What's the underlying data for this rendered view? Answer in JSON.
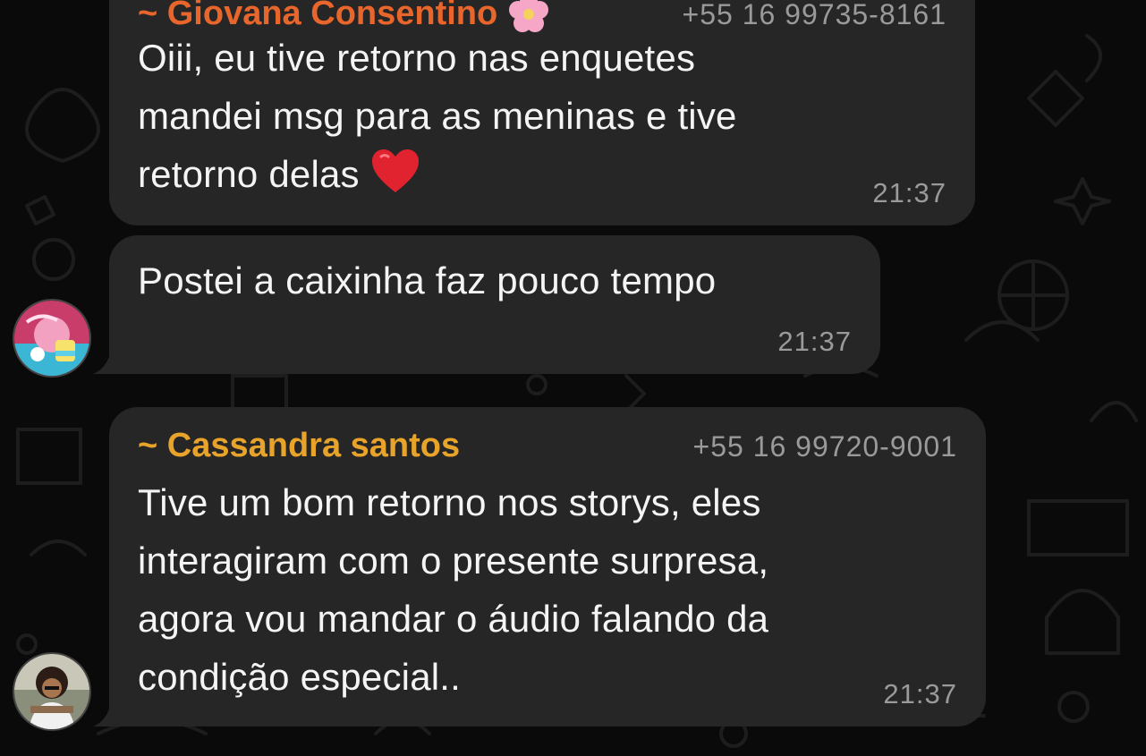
{
  "messages": [
    {
      "sender": "~ Giovana Consentino",
      "sender_emoji": "flower-emoji",
      "phone": "+55 16 99735-8161",
      "text": "Oiii, eu tive retorno nas enquetes\nmandei msg para as meninas e tive\nretorno delas",
      "emoji": "red-heart-emoji",
      "time": "21:37",
      "name_color": "#e8662b"
    },
    {
      "text": "Postei a caixinha faz pouco tempo",
      "time": "21:37"
    },
    {
      "sender": "~ Cassandra santos",
      "phone": "+55 16 99720-9001",
      "text": "Tive um bom retorno nos storys, eles\ninteragiram com o presente surpresa,\nagora vou mandar o áudio falando da\ncondição especial..",
      "time": "21:37",
      "name_color": "#e7a32a"
    }
  ],
  "colors": {
    "bubble": "#262626",
    "background": "#0a0a0a",
    "timestamp": "#9a9a9a"
  }
}
